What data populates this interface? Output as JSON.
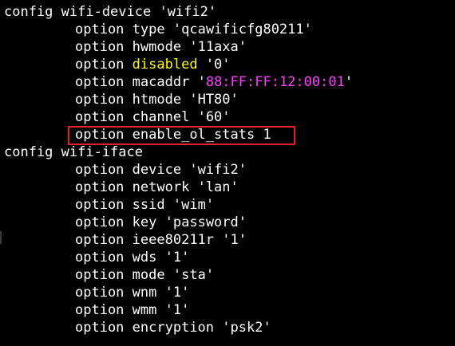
{
  "colors": {
    "background": "#000000",
    "text": "#ffffff",
    "keyword_yellow": "#ffff00",
    "value_magenta": "#ff40ff",
    "highlight_border": "#e0202a"
  },
  "block1": {
    "header": "config wifi-device 'wifi2'",
    "options": [
      {
        "kw": "option",
        "key": "type",
        "value": "'qcawificfg80211'"
      },
      {
        "kw": "option",
        "key": "hwmode",
        "value": "'11axa'"
      },
      {
        "kw": "option",
        "key": "disabled",
        "value": "'0'"
      },
      {
        "kw": "option",
        "key": "macaddr",
        "value_pre": "'",
        "value_mid": "88:FF:FF:12:00:01",
        "value_post": "'"
      },
      {
        "kw": "option",
        "key": "htmode",
        "value": "'HT80'"
      },
      {
        "kw": "option",
        "key": "channel",
        "value": "'60'"
      },
      {
        "kw": "option",
        "key": "enable_ol_stats",
        "value": "1"
      }
    ]
  },
  "block2": {
    "header": "config wifi-iface",
    "options": [
      {
        "kw": "option",
        "key": "device",
        "value": "'wifi2'"
      },
      {
        "kw": "option",
        "key": "network",
        "value": "'lan'"
      },
      {
        "kw": "option",
        "key": "ssid",
        "value": "'wim'"
      },
      {
        "kw": "option",
        "key": "key",
        "value": "'password'"
      },
      {
        "kw": "option",
        "key": "ieee80211r",
        "value": "'1'"
      },
      {
        "kw": "option",
        "key": "wds",
        "value": "'1'"
      },
      {
        "kw": "option",
        "key": "mode",
        "value": "'sta'"
      },
      {
        "kw": "option",
        "key": "wnm",
        "value": "'1'"
      },
      {
        "kw": "option",
        "key": "wmm",
        "value": "'1'"
      },
      {
        "kw": "option",
        "key": "encryption",
        "value": "'psk2'"
      }
    ]
  }
}
